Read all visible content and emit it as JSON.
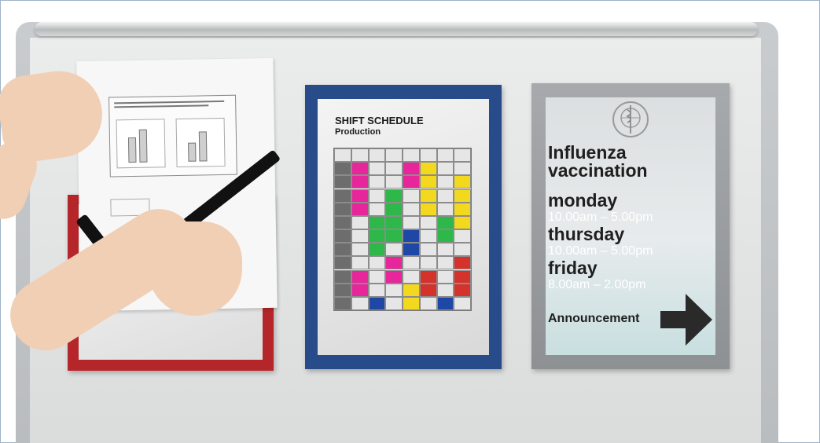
{
  "schedule": {
    "title": "SHIFT SCHEDULE",
    "subtitle": "Production"
  },
  "poster": {
    "heading_line1": "Influenza",
    "heading_line2": "vaccination",
    "days": [
      {
        "day": "monday",
        "time": "10.00am – 5.00pm"
      },
      {
        "day": "thursday",
        "time": "10.00am – 5.00pm"
      },
      {
        "day": "friday",
        "time": "8.00am – 2.00pm"
      }
    ],
    "announcement": "Announcement",
    "emblem_icon": "who-emblem-icon",
    "arrow_icon": "arrow-right-icon"
  },
  "frame_colors": {
    "red": "#b5262a",
    "blue": "#284b8a",
    "silver": "#9c9fa2",
    "strip": "#111111"
  },
  "schedule_colors": {
    "magenta": "#e6269a",
    "yellow": "#f2d81f",
    "green": "#2fb84a",
    "blue": "#1f47a6",
    "red": "#d6322c",
    "gray": "#e6e6e6"
  }
}
